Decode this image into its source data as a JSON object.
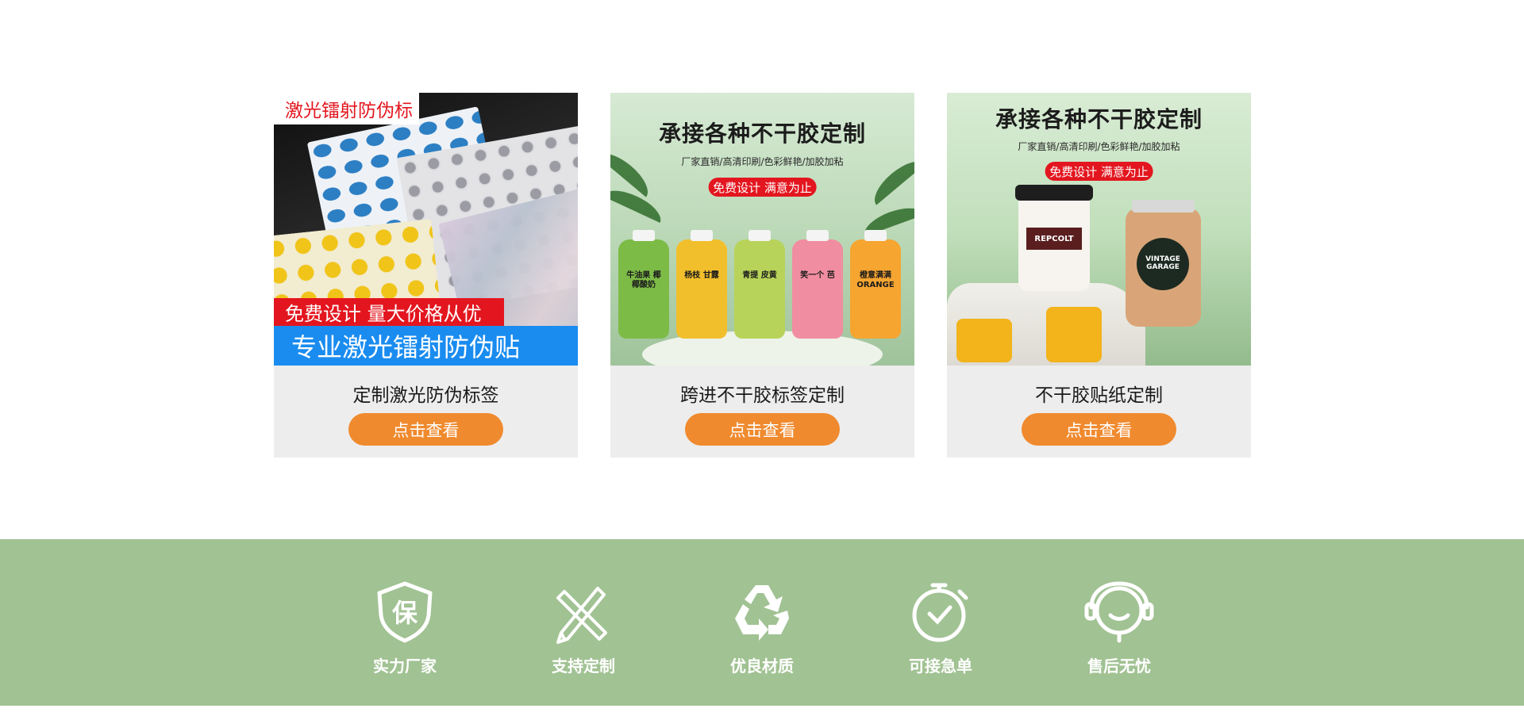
{
  "products": [
    {
      "image_texts": {
        "top_tag": "激光镭射防伪标",
        "red_banner": "免费设计 量大价格从优",
        "blue_banner": "专业激光镭射防伪贴"
      },
      "title": "定制激光防伪标签",
      "button": "点击查看"
    },
    {
      "image_texts": {
        "headline": "承接各种不干胶定制",
        "subline": "厂家直销/高清印刷/色彩鲜艳/加胶加粘",
        "badge": "免费设计 满意为止",
        "bottle_labels": [
          "牛油果 椰椰酸奶",
          "杨枝 甘露",
          "青提 皮黄",
          "笑一个 芭",
          "橙意满满 ORANGE"
        ]
      },
      "title": "跨进不干胶标签定制",
      "button": "点击查看"
    },
    {
      "image_texts": {
        "headline": "承接各种不干胶定制",
        "subline": "厂家直销/高清印刷/色彩鲜艳/加胶加粘",
        "badge": "免费设计 满意为止",
        "cup_label": "REPCOLT",
        "jar_label": "VINTAGE GARAGE"
      },
      "title": "不干胶贴纸定制",
      "button": "点击查看"
    }
  ],
  "features": [
    {
      "icon": "shield-icon",
      "glyph": "保",
      "label": "实力厂家"
    },
    {
      "icon": "pencil-ruler-icon",
      "label": "支持定制"
    },
    {
      "icon": "recycle-icon",
      "label": "优良材质"
    },
    {
      "icon": "stopwatch-icon",
      "label": "可接急单"
    },
    {
      "icon": "headset-icon",
      "label": "售后无忧"
    }
  ],
  "colors": {
    "accent_button": "#f08a2e",
    "feature_band": "#a1c293",
    "card_bg": "#ededed",
    "promo_red": "#e3161f",
    "promo_blue": "#1a8cf0"
  }
}
